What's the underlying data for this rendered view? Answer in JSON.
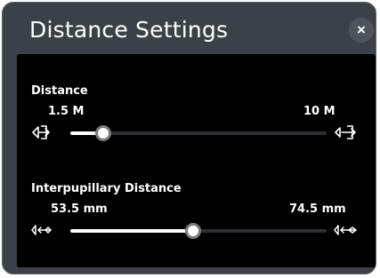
{
  "dialog": {
    "title": "Distance Settings",
    "close_label": "×"
  },
  "distance": {
    "label": "Distance",
    "min_label": "1.5 M",
    "max_label": "10 M",
    "value_fraction": 0.13,
    "min_icon": "view-near-icon",
    "max_icon": "view-far-icon"
  },
  "ipd": {
    "label": "Interpupillary Distance",
    "min_label": "53.5 mm",
    "max_label": "74.5 mm",
    "value_fraction": 0.48,
    "min_icon": "eyes-narrow-icon",
    "max_icon": "eyes-wide-icon"
  }
}
